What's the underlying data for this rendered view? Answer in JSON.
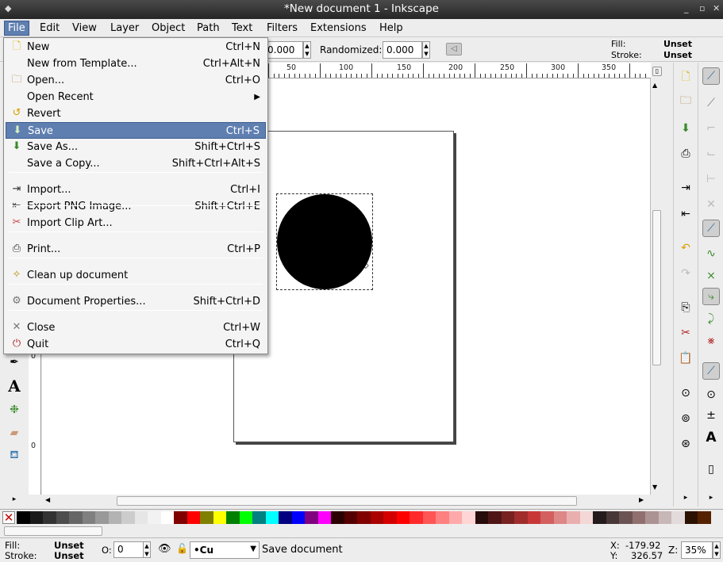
{
  "window": {
    "title": "*New document 1 - Inkscape"
  },
  "menubar": [
    "File",
    "Edit",
    "View",
    "Layer",
    "Object",
    "Path",
    "Text",
    "Filters",
    "Extensions",
    "Help"
  ],
  "toolcontrols": {
    "value1": "0.000",
    "randomized_label": "Randomized:",
    "randomized_value": "0.000"
  },
  "style_indicator": {
    "fill_label": "Fill:",
    "fill_value": "Unset",
    "stroke_label": "Stroke:",
    "stroke_value": "Unset"
  },
  "ruler": {
    "h_labels": [
      "50",
      "100",
      "150",
      "200",
      "250",
      "300",
      "350"
    ],
    "v_labels": [
      "0",
      "0"
    ]
  },
  "file_menu": {
    "items": [
      {
        "label": "New",
        "accel": "Ctrl+N",
        "icon": "new-document-icon"
      },
      {
        "label": "New from Template...",
        "accel": "Ctrl+Alt+N",
        "icon": ""
      },
      {
        "label": "Open...",
        "accel": "Ctrl+O",
        "icon": "open-folder-icon"
      },
      {
        "label": "Open Recent",
        "accel": "",
        "icon": "",
        "submenu": true
      },
      {
        "label": "Revert",
        "accel": "",
        "icon": "revert-icon"
      },
      {
        "label": "Save",
        "accel": "Ctrl+S",
        "icon": "save-icon",
        "highlighted": true
      },
      {
        "label": "Save As...",
        "accel": "Shift+Ctrl+S",
        "icon": "save-as-icon"
      },
      {
        "label": "Save a Copy...",
        "accel": "Shift+Ctrl+Alt+S",
        "icon": ""
      },
      {
        "label": "Import...",
        "accel": "Ctrl+I",
        "icon": "import-icon"
      },
      {
        "label": "Export PNG Image...",
        "accel": "Shift+Ctrl+E",
        "icon": "export-icon"
      },
      {
        "label": "Import Clip Art...",
        "accel": "",
        "icon": "clipart-icon"
      },
      {
        "label": "Print...",
        "accel": "Ctrl+P",
        "icon": "print-icon"
      },
      {
        "label": "Clean up document",
        "accel": "",
        "icon": "cleanup-icon"
      },
      {
        "label": "Document Properties...",
        "accel": "Shift+Ctrl+D",
        "icon": "doc-properties-icon"
      },
      {
        "label": "Close",
        "accel": "Ctrl+W",
        "icon": "close-icon"
      },
      {
        "label": "Quit",
        "accel": "Ctrl+Q",
        "icon": "quit-icon"
      }
    ]
  },
  "statusbar": {
    "fill_label": "Fill:",
    "fill_value": "Unset",
    "stroke_label": "Stroke:",
    "stroke_value": "Unset",
    "opacity_label": "O:",
    "opacity_value": "0",
    "layer_value": "•Cu",
    "message": "Save document",
    "x_label": "X:",
    "x_value": "-179.92",
    "y_label": "Y:",
    "y_value": "326.57",
    "zoom_label": "Z:",
    "zoom_value": "35%"
  },
  "colors": {
    "menu_highlight": "#5f7fb0",
    "palette": [
      "#000000",
      "#1a1a1a",
      "#333333",
      "#4d4d4d",
      "#666666",
      "#808080",
      "#999999",
      "#b3b3b3",
      "#cccccc",
      "#e6e6e6",
      "#f2f2f2",
      "#ffffff",
      "#800000",
      "#ff0000",
      "#808000",
      "#ffff00",
      "#008000",
      "#00ff00",
      "#008080",
      "#00ffff",
      "#000080",
      "#0000ff",
      "#800080",
      "#ff00ff",
      "#2b0000",
      "#550000",
      "#800000",
      "#aa0000",
      "#d40000",
      "#ff0000",
      "#ff2a2a",
      "#ff5555",
      "#ff8080",
      "#ffaaaa",
      "#ffd5d5",
      "#280b0b",
      "#501616",
      "#782121",
      "#a02c2c",
      "#c83737",
      "#d35f5f",
      "#de8787",
      "#e9afaf",
      "#f4d7d7",
      "#241c1c",
      "#483737",
      "#6c5353",
      "#916f6f",
      "#ac9393",
      "#c8b7b7",
      "#e3dbdb",
      "#2b1100",
      "#552200"
    ]
  }
}
